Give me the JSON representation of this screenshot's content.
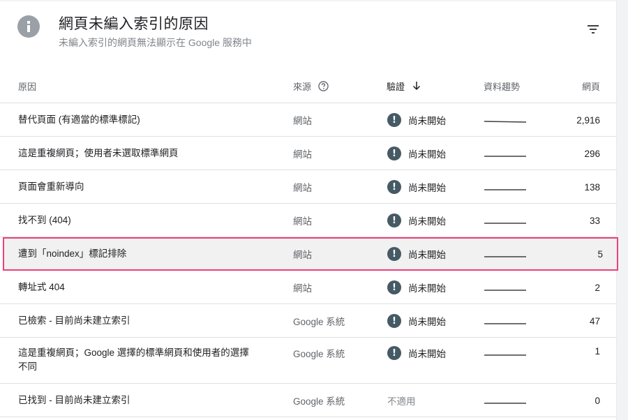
{
  "header": {
    "title": "網頁未編入索引的原因",
    "subtitle": "未編入索引的網頁無法顯示在 Google 服務中",
    "icon": "info-icon",
    "filter_icon": "filter-icon"
  },
  "table": {
    "columns": {
      "reason": "原因",
      "source": "來源",
      "validation": "驗證",
      "trend": "資料趨勢",
      "pages": "網頁"
    },
    "rows": [
      {
        "reason": "替代頁面 (有適當的標準標記)",
        "source": "網站",
        "validation": "尚未開始",
        "pages": "2,916"
      },
      {
        "reason": "這是重複網頁；使用者未選取標準網頁",
        "source": "網站",
        "validation": "尚未開始",
        "pages": "296"
      },
      {
        "reason": "頁面會重新導向",
        "source": "網站",
        "validation": "尚未開始",
        "pages": "138"
      },
      {
        "reason": "找不到 (404)",
        "source": "網站",
        "validation": "尚未開始",
        "pages": "33"
      },
      {
        "reason": "遭到「noindex」標記排除",
        "source": "網站",
        "validation": "尚未開始",
        "pages": "5"
      },
      {
        "reason": "轉址式 404",
        "source": "網站",
        "validation": "尚未開始",
        "pages": "2"
      },
      {
        "reason": "已檢索 - 目前尚未建立索引",
        "source": "Google 系統",
        "validation": "尚未開始",
        "pages": "47"
      },
      {
        "reason": "這是重複網頁；Google 選擇的標準網頁和使用者的選擇不同",
        "source": "Google 系統",
        "validation": "尚未開始",
        "pages": "1"
      },
      {
        "reason": "已找到 - 目前尚未建立索引",
        "source": "Google 系統",
        "validation": "不適用",
        "pages": "0"
      }
    ]
  },
  "colors": {
    "highlight_border": "#ec407a",
    "warning_icon": "#455a64"
  }
}
